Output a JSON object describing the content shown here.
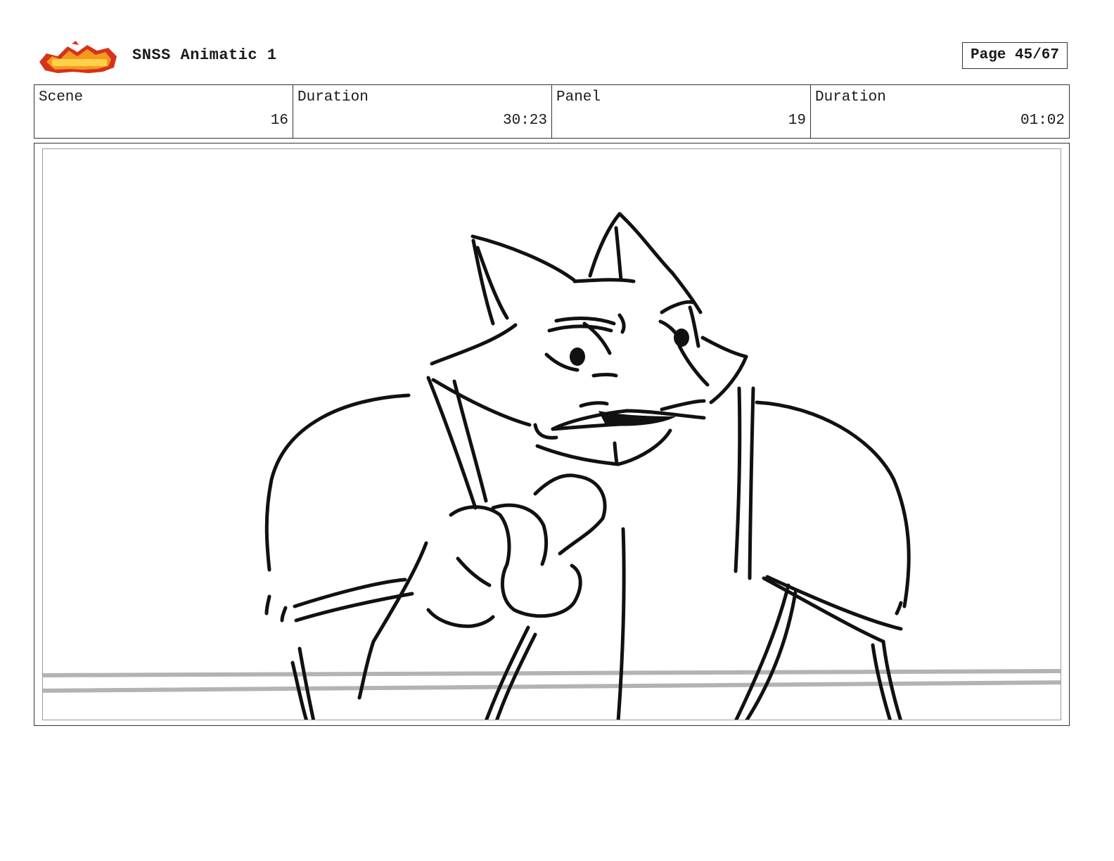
{
  "header": {
    "title": "SNSS Animatic 1",
    "page": "Page 45/67"
  },
  "info": {
    "scene_label": "Scene",
    "scene_value": "16",
    "scene_duration_label": "Duration",
    "scene_duration_value": "30:23",
    "panel_label": "Panel",
    "panel_value": "19",
    "panel_duration_label": "Duration",
    "panel_duration_value": "01:02"
  },
  "colors": {
    "logo_red": "#d6321c",
    "logo_orange": "#f39a1e",
    "ink": "#111111",
    "floor_line": "#b3b3b3"
  }
}
